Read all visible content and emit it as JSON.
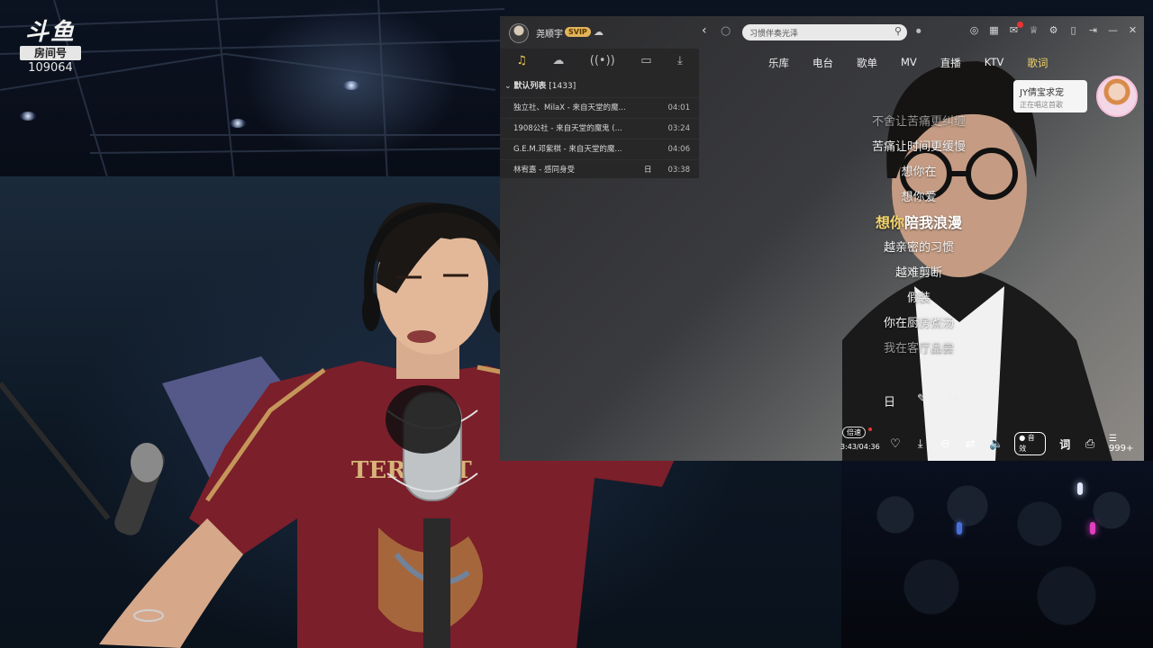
{
  "stream": {
    "logo_mark": "斗鱼",
    "room_label": "房间号",
    "room_number": "109064"
  },
  "app": {
    "username": "尧顺宇",
    "vip_badge": "SVIP",
    "search_text": "习惯伴奏光泽",
    "sidebar_icons": [
      "music-note-icon",
      "cloud-icon",
      "radio-icon",
      "device-icon",
      "download-icon"
    ],
    "playlist_title": "默认列表",
    "playlist_count": "[1433]",
    "tracks": [
      {
        "name": "独立社、MilaX - 来自天堂的魔...",
        "time": "04:01"
      },
      {
        "name": "1908公社 - 来自天堂的魔鬼 (...",
        "time": "03:24"
      },
      {
        "name": "G.E.M.邓紫棋 - 来自天堂的魔...",
        "time": "04:06"
      },
      {
        "name": "林宥嘉 - 感同身受",
        "time": "03:38",
        "icon": "日"
      }
    ],
    "menu": [
      "乐库",
      "电台",
      "歌单",
      "MV",
      "直播",
      "KTV",
      "歌词"
    ],
    "chat": {
      "line1": "JY倩宝求宠",
      "line2": "正在唱这首歌"
    },
    "lyrics": [
      {
        "text": "不舍让苦痛更纠缠",
        "state": "dim"
      },
      {
        "text": "苦痛让时间更缓慢",
        "state": "normal"
      },
      {
        "text": "想你在",
        "state": "normal"
      },
      {
        "text": "想你爱",
        "state": "normal"
      },
      {
        "sung": "想你",
        "rest": "陪我浪漫",
        "state": "current"
      },
      {
        "text": "越亲密的习惯",
        "state": "normal"
      },
      {
        "text": "越难剪断",
        "state": "normal"
      },
      {
        "text": "假装",
        "state": "normal"
      },
      {
        "text": "你在厨房煮汤",
        "state": "normal"
      },
      {
        "text": "我在客厅品尝",
        "state": "dim"
      }
    ],
    "lyric_tools": [
      "日",
      "✎",
      "⇄"
    ],
    "player": {
      "speed_label": "倍速",
      "time": "3:43/04:36",
      "sound_effect": "音效",
      "lyric_toggle": "词",
      "queue_count": "999+"
    }
  }
}
